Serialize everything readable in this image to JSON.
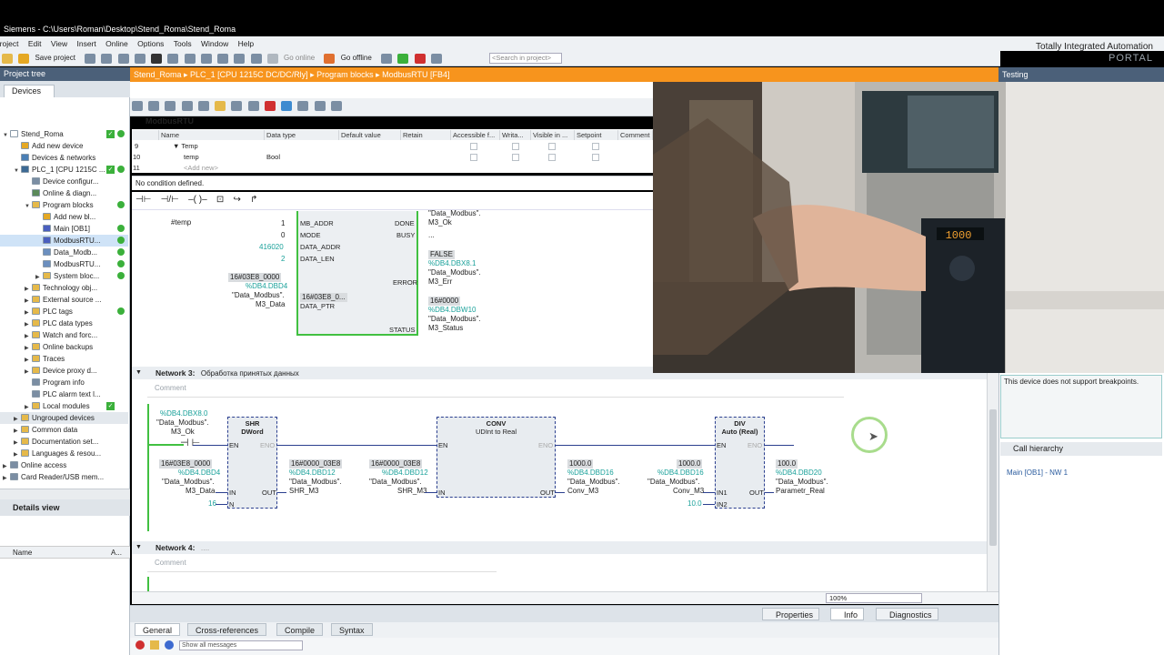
{
  "window": {
    "title": "Siemens - C:\\Users\\Roman\\Desktop\\Stend_Roma\\Stend_Roma"
  },
  "menu": [
    "Project",
    "Edit",
    "View",
    "Insert",
    "Online",
    "Options",
    "Tools",
    "Window",
    "Help"
  ],
  "toolbar": {
    "save_label": "Save project",
    "go_online": "Go online",
    "go_offline": "Go offline",
    "search_placeholder": "<Search in project>"
  },
  "brand": {
    "line1": "Totally Integrated Automation",
    "line2": "PORTAL"
  },
  "project_tree": {
    "header": "Project tree",
    "tab": "Devices",
    "items": [
      {
        "label": "Stend_Roma",
        "indent": 0,
        "tri": "▼",
        "color": "#ffffff",
        "check": true,
        "dot": true
      },
      {
        "label": "Add new device",
        "indent": 1,
        "tri": "",
        "color": "#e5a823"
      },
      {
        "label": "Devices & networks",
        "indent": 1,
        "tri": "",
        "color": "#4a7fb5"
      },
      {
        "label": "PLC_1 [CPU 1215C ...",
        "indent": 1,
        "tri": "▼",
        "color": "#3d6a94",
        "check": true,
        "dot": true
      },
      {
        "label": "Device configur...",
        "indent": 2,
        "tri": "",
        "color": "#7b8ea3"
      },
      {
        "label": "Online & diagn...",
        "indent": 2,
        "tri": "",
        "color": "#5a8a5a"
      },
      {
        "label": "Program blocks",
        "indent": 2,
        "tri": "▼",
        "color": "#e5b94a",
        "dot": true
      },
      {
        "label": "Add new bl...",
        "indent": 3,
        "tri": "",
        "color": "#e5a823"
      },
      {
        "label": "Main [OB1]",
        "indent": 3,
        "tri": "",
        "color": "#4a5fbf",
        "dot": true
      },
      {
        "label": "ModbusRTU...",
        "indent": 3,
        "tri": "",
        "color": "#4a5fbf",
        "dot": true,
        "sel": true
      },
      {
        "label": "Data_Modb...",
        "indent": 3,
        "tri": "",
        "color": "#6b8fbf",
        "dot": true
      },
      {
        "label": "ModbusRTU...",
        "indent": 3,
        "tri": "",
        "color": "#6b8fbf",
        "dot": true
      },
      {
        "label": "System bloc...",
        "indent": 3,
        "tri": "▶",
        "color": "#e5b94a",
        "dot": true
      },
      {
        "label": "Technology obj...",
        "indent": 2,
        "tri": "▶",
        "color": "#e5b94a"
      },
      {
        "label": "External source ...",
        "indent": 2,
        "tri": "▶",
        "color": "#e5b94a"
      },
      {
        "label": "PLC tags",
        "indent": 2,
        "tri": "▶",
        "color": "#e5b94a",
        "dot": true
      },
      {
        "label": "PLC data types",
        "indent": 2,
        "tri": "▶",
        "color": "#e5b94a"
      },
      {
        "label": "Watch and forc...",
        "indent": 2,
        "tri": "▶",
        "color": "#e5b94a"
      },
      {
        "label": "Online backups",
        "indent": 2,
        "tri": "▶",
        "color": "#e5b94a"
      },
      {
        "label": "Traces",
        "indent": 2,
        "tri": "▶",
        "color": "#e5b94a"
      },
      {
        "label": "Device proxy d...",
        "indent": 2,
        "tri": "▶",
        "color": "#e5b94a"
      },
      {
        "label": "Program info",
        "indent": 2,
        "tri": "",
        "color": "#7b8ea3"
      },
      {
        "label": "PLC alarm text l...",
        "indent": 2,
        "tri": "",
        "color": "#7b8ea3"
      },
      {
        "label": "Local modules",
        "indent": 2,
        "tri": "▶",
        "color": "#e5b94a",
        "check": true
      },
      {
        "label": "Ungrouped devices",
        "indent": 1,
        "tri": "▶",
        "color": "#e5b94a",
        "bg": true
      },
      {
        "label": "Common data",
        "indent": 1,
        "tri": "▶",
        "color": "#e5b94a"
      },
      {
        "label": "Documentation set...",
        "indent": 1,
        "tri": "▶",
        "color": "#e5b94a"
      },
      {
        "label": "Languages & resou...",
        "indent": 1,
        "tri": "▶",
        "color": "#e5b94a"
      },
      {
        "label": "Online access",
        "indent": 0,
        "tri": "▶",
        "color": "#7b8ea3"
      },
      {
        "label": "Card Reader/USB mem...",
        "indent": 0,
        "tri": "▶",
        "color": "#7b8ea3"
      }
    ]
  },
  "details_view": {
    "title": "Details view",
    "col_name": "Name",
    "col_a": "A..."
  },
  "editor": {
    "breadcrumb": "Stend_Roma  ▸  PLC_1 [CPU 1215C DC/DC/Rly]  ▸  Program blocks  ▸  ModbusRTU [FB4]",
    "block_name": "ModbusRTU",
    "iface_cols": [
      "Name",
      "Data type",
      "Default value",
      "Retain",
      "Accessible f...",
      "Writa...",
      "Visible in ...",
      "Setpoint",
      "Comment"
    ],
    "iface_rows": [
      {
        "num": "9",
        "name": "▼  Temp",
        "type": ""
      },
      {
        "num": "10",
        "name": "temp",
        "type": "Bool"
      },
      {
        "num": "11",
        "name": "<Add new>",
        "type": ""
      }
    ],
    "no_condition": "No condition defined.",
    "net2": {
      "temp": "#temp",
      "mb_addr_val": "1",
      "mode_val": "0",
      "data_addr_val": "416020",
      "data_len_val": "2",
      "ptr_val": "16#03E8_0000",
      "ptr_addr": "%DB4.DBD4",
      "ptr_name1": "\"Data_Modbus\".",
      "ptr_name2": "M3_Data",
      "ptr_inner": "16#03E8_0...",
      "pins_in": [
        "MB_ADDR",
        "MODE",
        "DATA_ADDR",
        "DATA_LEN",
        "DATA_PTR"
      ],
      "pins_out": [
        "DONE",
        "BUSY",
        "ERROR",
        "STATUS"
      ],
      "done_top": "\"Data_Modbus\".",
      "done_tag": "M3_Ok",
      "busy_tag": "...",
      "err_val": "FALSE",
      "err_addr": "%DB4.DBX8.1",
      "err_name": "\"Data_Modbus\".",
      "err_tag": "M3_Err",
      "status_val": "16#0000",
      "status_addr": "%DB4.DBW10",
      "status_name": "\"Data_Modbus\".",
      "status_tag": "M3_Status"
    },
    "net3": {
      "title": "Network 3:",
      "subtitle": "Обработка принятых данных",
      "comment": "Comment",
      "contact_addr": "%DB4.DBX8.0",
      "contact_name": "\"Data_Modbus\".",
      "contact_tag": "M3_Ok",
      "shr_title": "SHR",
      "shr_type": "DWord",
      "shr_in_val": "16#03E8_0000",
      "shr_in_addr": "%DB4.DBD4",
      "shr_in_name": "\"Data_Modbus\".",
      "shr_in_tag": "M3_Data",
      "shr_n": "16",
      "shr_out_val": "16#0000_03E8",
      "shr_out_addr": "%DB4.DBD12",
      "shr_out_name": "\"Data_Modbus\".",
      "shr_out_tag": "SHR_M3",
      "conv_title": "CONV",
      "conv_type": "UDInt  to  Real",
      "conv_in_val": "16#0000_03E8",
      "conv_in_addr": "%DB4.DBD12",
      "conv_in_name": "\"Data_Modbus\".",
      "conv_in_tag": "SHR_M3",
      "conv_out_val": "1000.0",
      "conv_out_addr": "%DB4.DBD16",
      "conv_out_name": "\"Data_Modbus\".",
      "conv_out_tag": "Conv_M3",
      "div_title": "DIV",
      "div_type": "Auto (Real)",
      "div_in1_val": "1000.0",
      "div_in1_addr": "%DB4.DBD16",
      "div_in1_name": "\"Data_Modbus\".",
      "div_in1_tag": "Conv_M3",
      "div_in2": "10.0",
      "div_out_val": "100.0",
      "div_out_addr": "%DB4.DBD20",
      "div_out_name": "\"Data_Modbus\".",
      "div_out_tag": "Parametr_Real",
      "en": "EN",
      "eno": "ENO",
      "in": "IN",
      "n": "N",
      "out": "OUT",
      "in1": "IN1",
      "in2": "IN2"
    },
    "net4": {
      "title": "Network 4:",
      "subtitle": "....",
      "comment": "Comment"
    },
    "zoom": "100%"
  },
  "testing": {
    "header": "Testing",
    "bp_msg": "This device does not support breakpoints.",
    "call_hierarchy": "Call hierarchy",
    "call_item": "Main [OB1] - NW 1"
  },
  "inspector": {
    "properties": "Properties",
    "info": "Info",
    "diagnostics": "Diagnostics"
  },
  "bottom_tabs": [
    "General",
    "Cross-references",
    "Compile",
    "Syntax"
  ],
  "messages": {
    "filter": "Show all messages"
  },
  "video": {
    "display": "1000"
  }
}
